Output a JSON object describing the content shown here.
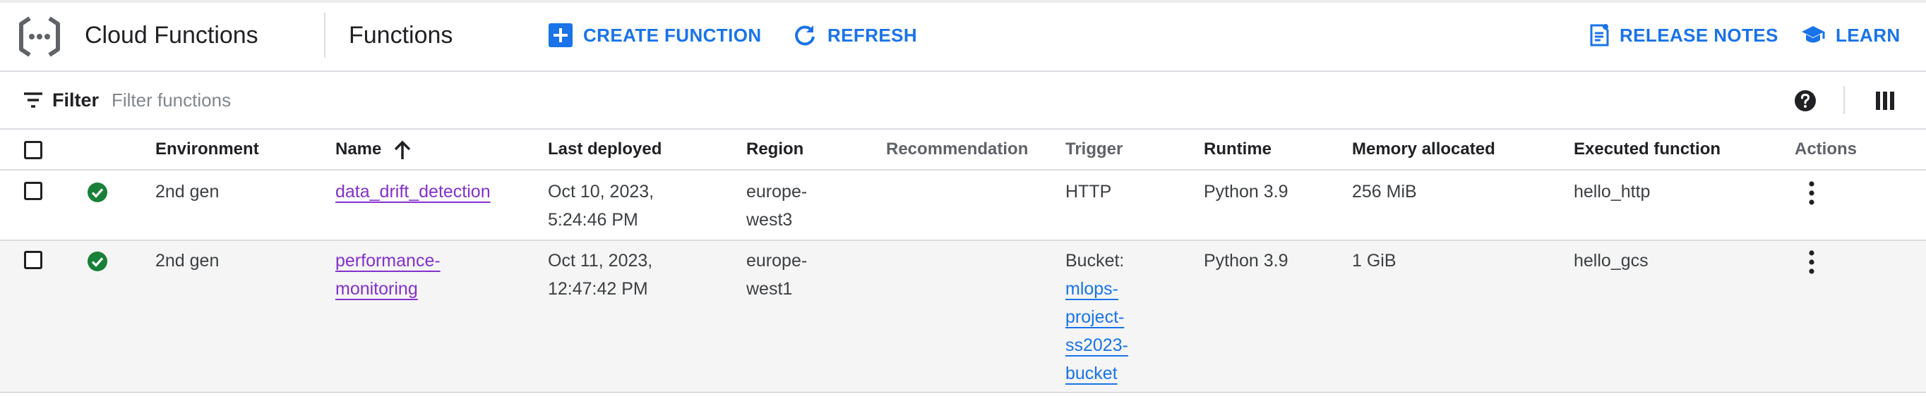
{
  "header": {
    "app_title": "Cloud Functions",
    "page_title": "Functions",
    "create_label": "CREATE FUNCTION",
    "refresh_label": "REFRESH",
    "release_notes_label": "RELEASE NOTES",
    "learn_label": "LEARN"
  },
  "filter": {
    "label": "Filter",
    "placeholder": "Filter functions"
  },
  "table": {
    "columns": {
      "environment": "Environment",
      "name": "Name",
      "last_deployed": "Last deployed",
      "region": "Region",
      "recommendation": "Recommendation",
      "trigger": "Trigger",
      "runtime": "Runtime",
      "memory": "Memory allocated",
      "executed_function": "Executed function",
      "actions": "Actions"
    },
    "sort": {
      "column": "Name",
      "direction": "ascending"
    },
    "rows": [
      {
        "status": "ok",
        "environment": "2nd gen",
        "name_lines": [
          "data_drift_detection"
        ],
        "last_deployed_lines": [
          "Oct 10, 2023,",
          "5:24:46 PM"
        ],
        "region_lines": [
          "europe-",
          "west3"
        ],
        "recommendation": "",
        "trigger_lines": [
          "HTTP"
        ],
        "runtime": "Python 3.9",
        "memory": "256 MiB",
        "executed_function": "hello_http"
      },
      {
        "status": "ok",
        "environment": "2nd gen",
        "name_lines": [
          "performance-",
          "monitoring"
        ],
        "last_deployed_lines": [
          "Oct 11, 2023,",
          "12:47:42 PM"
        ],
        "region_lines": [
          "europe-",
          "west1"
        ],
        "recommendation": "",
        "trigger_label": "Bucket:",
        "trigger_link_lines": [
          "mlops-",
          "project-",
          "ss2023-",
          "bucket"
        ],
        "runtime": "Python 3.9",
        "memory": "1 GiB",
        "executed_function": "hello_gcs"
      }
    ]
  },
  "colors": {
    "primary": "#1a73e8",
    "visited_link": "#8430ce",
    "success": "#188038",
    "row_highlight": "#f5f5f5"
  },
  "icons": {
    "logo": "cloud-functions-logo",
    "create": "add-box-icon",
    "refresh": "refresh-icon",
    "release_notes": "release-notes-icon",
    "learn": "school-icon",
    "filter": "filter-list-icon",
    "help": "help-icon",
    "columns": "column-display-icon",
    "sort": "arrow-upward-icon",
    "status": "check-circle-icon",
    "actions": "more-vert-icon"
  }
}
